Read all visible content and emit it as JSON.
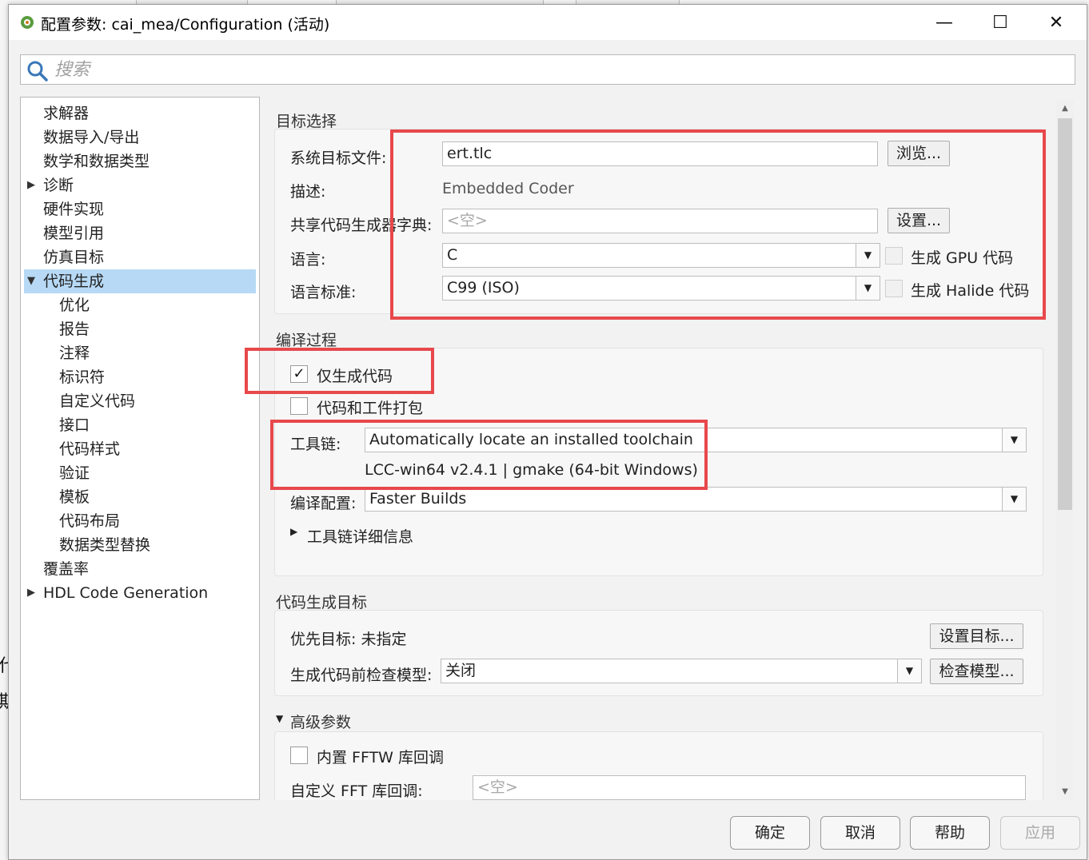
{
  "window": {
    "title": "配置参数: cai_mea/Configuration (活动)",
    "minimize": "—",
    "maximize": "☐",
    "close": "✕"
  },
  "search": {
    "placeholder": "搜索"
  },
  "background": {
    "fragments": [
      "代",
      "斯"
    ]
  },
  "tree": [
    {
      "label": "求解器",
      "expandable": false
    },
    {
      "label": "数据导入/导出",
      "expandable": false
    },
    {
      "label": "数学和数据类型",
      "expandable": false
    },
    {
      "label": "诊断",
      "expandable": true,
      "expanded": false
    },
    {
      "label": "硬件实现",
      "expandable": false
    },
    {
      "label": "模型引用",
      "expandable": false
    },
    {
      "label": "仿真目标",
      "expandable": false
    },
    {
      "label": "代码生成",
      "expandable": true,
      "expanded": true,
      "selected": true
    },
    {
      "label": "优化",
      "child": true
    },
    {
      "label": "报告",
      "child": true
    },
    {
      "label": "注释",
      "child": true
    },
    {
      "label": "标识符",
      "child": true
    },
    {
      "label": "自定义代码",
      "child": true
    },
    {
      "label": "接口",
      "child": true
    },
    {
      "label": "代码样式",
      "child": true
    },
    {
      "label": "验证",
      "child": true
    },
    {
      "label": "模板",
      "child": true
    },
    {
      "label": "代码布局",
      "child": true
    },
    {
      "label": "数据类型替换",
      "child": true
    },
    {
      "label": "覆盖率",
      "expandable": false
    },
    {
      "label": "HDL Code Generation",
      "expandable": true,
      "expanded": false
    }
  ],
  "target": {
    "section_title": "目标选择",
    "system_target_label": "系统目标文件:",
    "system_target_value": "ert.tlc",
    "browse_button": "浏览...",
    "description_label": "描述:",
    "description_value": "Embedded Coder",
    "shared_dict_label": "共享代码生成器字典:",
    "shared_dict_placeholder": "<空>",
    "settings_button": "设置...",
    "language_label": "语言:",
    "language_value": "C",
    "gpu_label": "生成 GPU 代码",
    "standard_label": "语言标准:",
    "standard_value": "C99 (ISO)",
    "halide_label": "生成 Halide 代码"
  },
  "build": {
    "section_title": "编译过程",
    "generate_only_label": "仅生成代码",
    "generate_only_checked": true,
    "package_label": "代码和工件打包",
    "package_checked": false,
    "toolchain_label": "工具链:",
    "toolchain_value": "Automatically locate an installed toolchain",
    "toolchain_detected": "LCC-win64 v2.4.1 | gmake (64-bit Windows)",
    "build_config_label": "编译配置:",
    "build_config_value": "Faster Builds",
    "toolchain_details_label": "工具链详细信息"
  },
  "objectives": {
    "section_title": "代码生成目标",
    "priority_label": "优先目标: 未指定",
    "set_objectives_button": "设置目标...",
    "check_model_label": "生成代码前检查模型:",
    "check_model_value": "关闭",
    "check_model_button": "检查模型..."
  },
  "advanced": {
    "section_title": "高级参数",
    "fftw_label": "内置 FFTW 库回调",
    "fft_label": "自定义 FFT 库回调:",
    "fft_placeholder": "<空>"
  },
  "footer": {
    "ok": "确定",
    "cancel": "取消",
    "help": "帮助",
    "apply": "应用"
  },
  "colors": {
    "highlight_box": "#e8484c",
    "selection": "#b7d9f5"
  }
}
